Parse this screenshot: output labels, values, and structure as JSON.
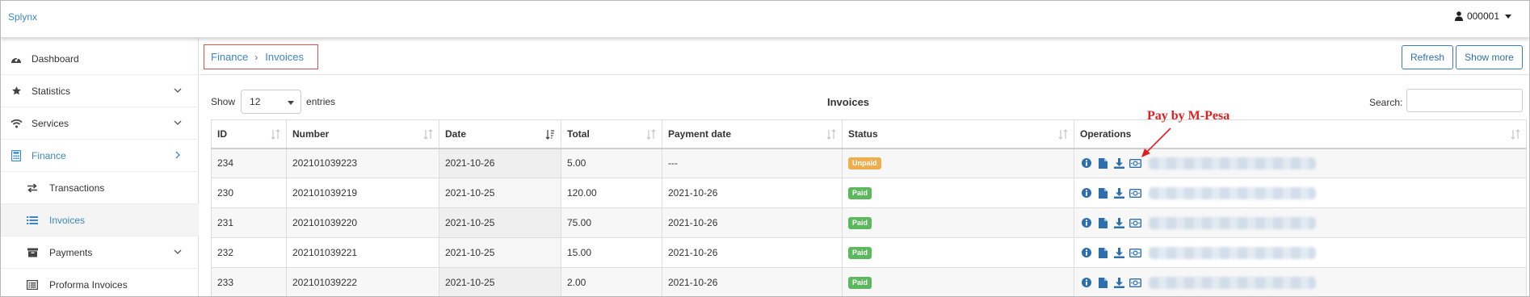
{
  "app": {
    "brand": "Splynx",
    "user": "000001"
  },
  "sidebar": {
    "items": [
      {
        "label": "Dashboard",
        "icon": "dashboard-icon"
      },
      {
        "label": "Statistics",
        "icon": "star-icon"
      },
      {
        "label": "Services",
        "icon": "wifi-icon"
      },
      {
        "label": "Finance",
        "icon": "calculator-icon"
      },
      {
        "label": "Transactions",
        "icon": "exchange-icon"
      },
      {
        "label": "Invoices",
        "icon": "list-icon"
      },
      {
        "label": "Payments",
        "icon": "archive-icon"
      },
      {
        "label": "Proforma Invoices",
        "icon": "list-alt-icon"
      }
    ]
  },
  "breadcrumb": {
    "parent": "Finance",
    "current": "Invoices"
  },
  "toolbar": {
    "refresh_label": "Refresh",
    "more_label": "Show more"
  },
  "table_controls": {
    "show_label": "Show",
    "entries_value": "12",
    "entries_label": "entries",
    "title": "Invoices",
    "search_label": "Search:"
  },
  "table": {
    "columns": [
      "ID",
      "Number",
      "Date",
      "Total",
      "Payment date",
      "Status",
      "Operations"
    ],
    "rows": [
      {
        "id": "234",
        "number": "202101039223",
        "date": "2021-10-26",
        "total": "5.00",
        "payment_date": "---",
        "status": "Unpaid"
      },
      {
        "id": "230",
        "number": "202101039219",
        "date": "2021-10-25",
        "total": "120.00",
        "payment_date": "2021-10-26",
        "status": "Paid"
      },
      {
        "id": "231",
        "number": "202101039220",
        "date": "2021-10-25",
        "total": "75.00",
        "payment_date": "2021-10-26",
        "status": "Paid"
      },
      {
        "id": "232",
        "number": "202101039221",
        "date": "2021-10-25",
        "total": "15.00",
        "payment_date": "2021-10-26",
        "status": "Paid"
      },
      {
        "id": "233",
        "number": "202101039222",
        "date": "2021-10-25",
        "total": "2.00",
        "payment_date": "2021-10-26",
        "status": "Paid"
      }
    ]
  },
  "annotation": {
    "text": "Pay by M-Pesa"
  },
  "colors": {
    "accent": "#3c86c4",
    "paid": "#5cb85c",
    "unpaid": "#f0ad4e",
    "annotation": "#e02020"
  }
}
